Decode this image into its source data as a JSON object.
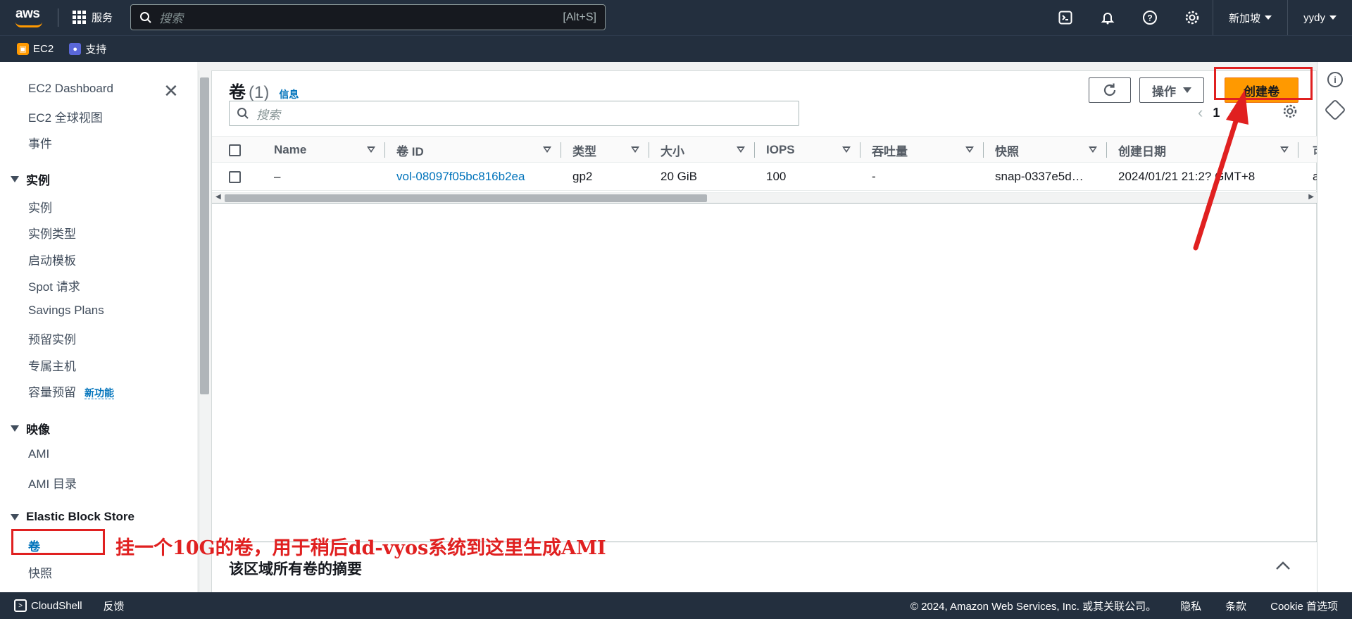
{
  "topnav": {
    "logo": "aws",
    "services_label": "服务",
    "search_placeholder": "搜索",
    "search_shortcut": "[Alt+S]",
    "region_label": "新加坡",
    "user_label": "yydy",
    "icons": [
      "cloudshell-icon",
      "bell-icon",
      "help-icon",
      "gear-icon"
    ]
  },
  "subnav": {
    "items": [
      {
        "label": "EC2",
        "icon": "ec2-icon",
        "color": "#ff9900"
      },
      {
        "label": "支持",
        "icon": "support-icon",
        "color": "#5a67d8"
      }
    ]
  },
  "sidebar": {
    "top_items": [
      "EC2 Dashboard",
      "EC2 全球视图",
      "事件"
    ],
    "sections": [
      {
        "title": "实例",
        "items": [
          "实例",
          "实例类型",
          "启动模板",
          "Spot 请求",
          "Savings Plans",
          "预留实例",
          "专属主机",
          "容量预留"
        ]
      },
      {
        "title": "映像",
        "items": [
          "AMI",
          "AMI 目录"
        ]
      },
      {
        "title": "Elastic Block Store",
        "items": [
          "卷",
          "快照"
        ]
      }
    ],
    "new_badge": "新功能"
  },
  "panel": {
    "title": "卷",
    "count": "(1)",
    "info_link": "信息",
    "refresh_icon": "refresh-icon",
    "actions_label": "操作",
    "create_label": "创建卷",
    "filter_placeholder": "搜索",
    "page_number": "1"
  },
  "table": {
    "columns": [
      "Name",
      "卷 ID",
      "类型",
      "大小",
      "IOPS",
      "吞吐量",
      "快照",
      "创建日期",
      "可"
    ],
    "rows": [
      {
        "name": "–",
        "volume_id": "vol-08097f05bc816b2ea",
        "type": "gp2",
        "size": "20 GiB",
        "iops": "100",
        "throughput": "-",
        "snapshot": "snap-0337e5d…",
        "created": "2024/01/21 21:2? GMT+8",
        "az": "a"
      }
    ]
  },
  "summary": {
    "title": "该区域所有卷的摘要"
  },
  "footer": {
    "cloudshell": "CloudShell",
    "feedback": "反馈",
    "copyright": "© 2024, Amazon Web Services, Inc. 或其关联公司。",
    "privacy": "隐私",
    "terms": "条款",
    "cookie": "Cookie 首选项"
  },
  "annotation": {
    "text": "挂一个10G的卷，用于稍后dd-vyos系统到这里生成AMI",
    "color": "#e02020"
  }
}
